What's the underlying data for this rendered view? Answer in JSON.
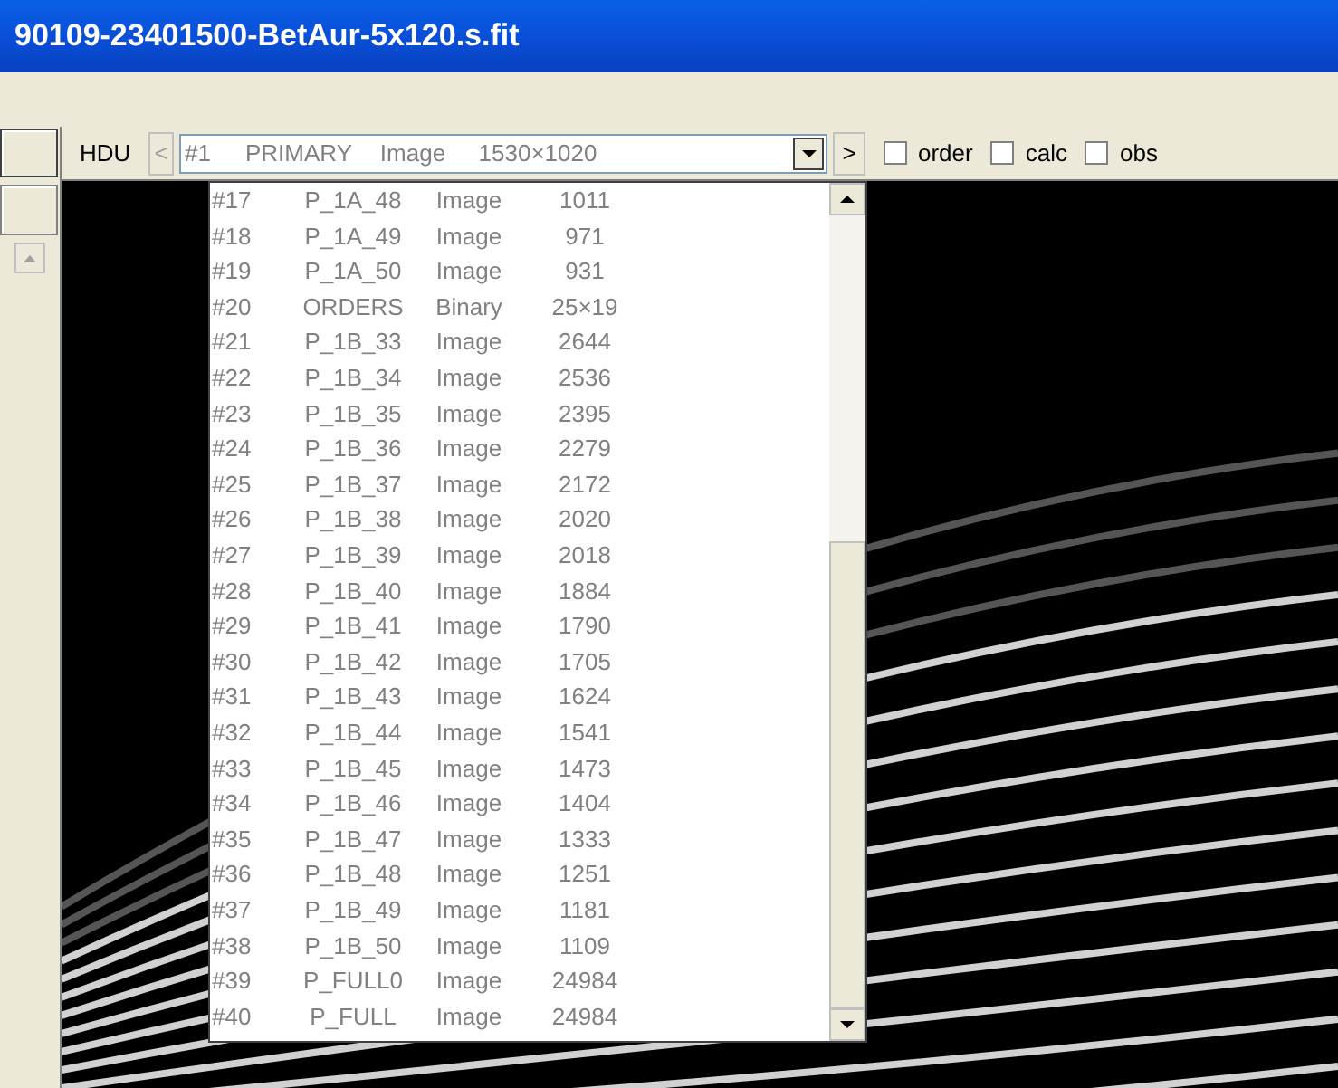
{
  "window": {
    "title": "90109-23401500-BetAur-5x120.s.fit"
  },
  "toolbar": {
    "hdu_label": "HDU",
    "prev_button": "<",
    "next_button": ">",
    "selected_hdu": {
      "number": "#1",
      "name": "PRIMARY",
      "type": "Image",
      "size": "1530×1020"
    },
    "checkboxes": [
      {
        "label": "order",
        "checked": false
      },
      {
        "label": "calc",
        "checked": false
      },
      {
        "label": "obs",
        "checked": false
      }
    ]
  },
  "dropdown": {
    "rows": [
      {
        "number": "#17",
        "name": "P_1A_48",
        "type": "Image",
        "size": "1011"
      },
      {
        "number": "#18",
        "name": "P_1A_49",
        "type": "Image",
        "size": "971"
      },
      {
        "number": "#19",
        "name": "P_1A_50",
        "type": "Image",
        "size": "931"
      },
      {
        "number": "#20",
        "name": "ORDERS",
        "type": "Binary",
        "size": "25×19"
      },
      {
        "number": "#21",
        "name": "P_1B_33",
        "type": "Image",
        "size": "2644"
      },
      {
        "number": "#22",
        "name": "P_1B_34",
        "type": "Image",
        "size": "2536"
      },
      {
        "number": "#23",
        "name": "P_1B_35",
        "type": "Image",
        "size": "2395"
      },
      {
        "number": "#24",
        "name": "P_1B_36",
        "type": "Image",
        "size": "2279"
      },
      {
        "number": "#25",
        "name": "P_1B_37",
        "type": "Image",
        "size": "2172"
      },
      {
        "number": "#26",
        "name": "P_1B_38",
        "type": "Image",
        "size": "2020"
      },
      {
        "number": "#27",
        "name": "P_1B_39",
        "type": "Image",
        "size": "2018"
      },
      {
        "number": "#28",
        "name": "P_1B_40",
        "type": "Image",
        "size": "1884"
      },
      {
        "number": "#29",
        "name": "P_1B_41",
        "type": "Image",
        "size": "1790"
      },
      {
        "number": "#30",
        "name": "P_1B_42",
        "type": "Image",
        "size": "1705"
      },
      {
        "number": "#31",
        "name": "P_1B_43",
        "type": "Image",
        "size": "1624"
      },
      {
        "number": "#32",
        "name": "P_1B_44",
        "type": "Image",
        "size": "1541"
      },
      {
        "number": "#33",
        "name": "P_1B_45",
        "type": "Image",
        "size": "1473"
      },
      {
        "number": "#34",
        "name": "P_1B_46",
        "type": "Image",
        "size": "1404"
      },
      {
        "number": "#35",
        "name": "P_1B_47",
        "type": "Image",
        "size": "1333"
      },
      {
        "number": "#36",
        "name": "P_1B_48",
        "type": "Image",
        "size": "1251"
      },
      {
        "number": "#37",
        "name": "P_1B_49",
        "type": "Image",
        "size": "1181"
      },
      {
        "number": "#38",
        "name": "P_1B_50",
        "type": "Image",
        "size": "1109"
      },
      {
        "number": "#39",
        "name": "P_FULL0",
        "type": "Image",
        "size": "24984"
      },
      {
        "number": "#40",
        "name": "P_FULL",
        "type": "Image",
        "size": "24984"
      }
    ]
  }
}
